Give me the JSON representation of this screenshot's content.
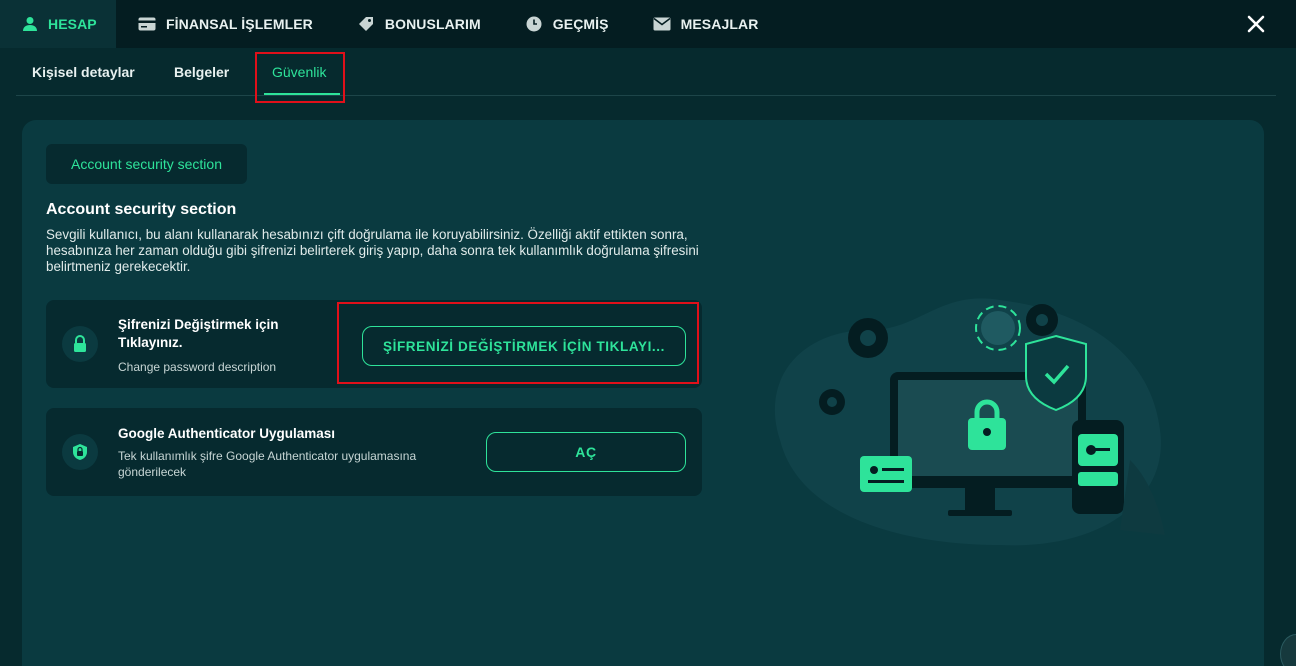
{
  "top_nav": {
    "tabs": [
      {
        "label": "HESAP",
        "icon": "user-icon",
        "active": true
      },
      {
        "label": "FİNANSAL İŞLEMLER",
        "icon": "card-icon"
      },
      {
        "label": "BONUSLARIM",
        "icon": "tag-icon"
      },
      {
        "label": "GEÇMİŞ",
        "icon": "clock-icon"
      },
      {
        "label": "MESAJLAR",
        "icon": "mail-icon"
      }
    ],
    "close_icon": "close-icon"
  },
  "sub_nav": {
    "tabs": [
      {
        "label": "Kişisel detaylar"
      },
      {
        "label": "Belgeler"
      },
      {
        "label": "Güvenlik",
        "active": true
      }
    ]
  },
  "security": {
    "chip_label": "Account security section",
    "heading": "Account security section",
    "description": "Sevgili kullanıcı, bu alanı kullanarak hesabınızı çift doğrulama ile koruyabilirsiniz. Özelliği aktif ettikten sonra, hesabınıza her zaman olduğu gibi şifrenizi belirterek giriş yapıp, daha sonra tek kullanımlık doğrulama şifresini belirtmeniz gerekecektir.",
    "password_panel": {
      "title": "Şifrenizi Değiştirmek için Tıklayınız.",
      "subtitle": "Change password description",
      "button_label": "ŞİFRENİZİ DEĞİŞTİRMEK İÇİN TIKLAYI...",
      "icon": "lock-icon"
    },
    "authenticator_panel": {
      "title": "Google Authenticator Uygulaması",
      "subtitle": "Tek kullanımlık şifre Google Authenticator uygulamasına gönderilecek",
      "button_label": "AÇ",
      "icon": "shield-lock-icon"
    }
  },
  "colors": {
    "accent": "#2ee39a",
    "background": "#062a2e",
    "card": "#0a3a40",
    "highlight": "#e0101a"
  }
}
